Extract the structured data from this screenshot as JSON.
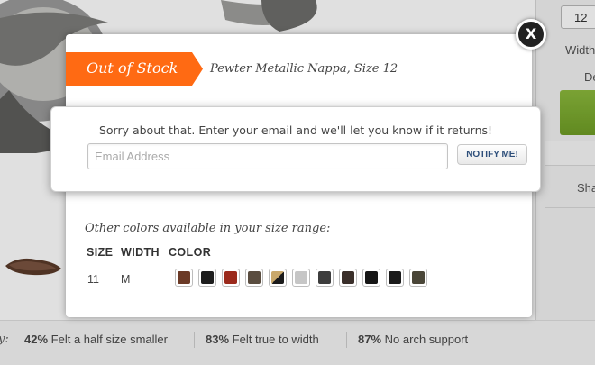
{
  "background": {
    "size_value": "12",
    "width_label": "Width",
    "de_label": "De",
    "share_label": "Sha",
    "fit": {
      "prefix": "y:",
      "stats": [
        {
          "percent": "42%",
          "text": "Felt a half size smaller"
        },
        {
          "percent": "83%",
          "text": "Felt true to width"
        },
        {
          "percent": "87%",
          "text": "No arch support"
        }
      ]
    }
  },
  "modal": {
    "close_label": "X",
    "banner_label": "Out of Stock",
    "banner_color": "#ff6a13",
    "product_name": "Pewter Metallic Nappa, Size 12",
    "notify": {
      "message": "Sorry about that. Enter your email and we'll let you know if it returns!",
      "email_placeholder": "Email Address",
      "button_label": "NOTIFY ME!"
    },
    "other_colors": {
      "label": "Other colors available in your size range:",
      "headers": {
        "size": "SIZE",
        "width": "WIDTH",
        "color": "COLOR"
      },
      "row": {
        "size": "11",
        "width": "M"
      },
      "swatches": [
        {
          "name": "brown",
          "color": "#6b3a26"
        },
        {
          "name": "black",
          "color": "#1d1d1d"
        },
        {
          "name": "red",
          "color": "#9b2a1c"
        },
        {
          "name": "taupe",
          "color": "#5a4d40"
        },
        {
          "name": "gold-black",
          "color": "gold-black"
        },
        {
          "name": "light-gray",
          "color": "#c6c6c6"
        },
        {
          "name": "charcoal",
          "color": "#3d3d3d"
        },
        {
          "name": "dark-brown",
          "color": "#3a2f2a"
        },
        {
          "name": "black-2",
          "color": "#161616"
        },
        {
          "name": "black-3",
          "color": "#1a1a1a"
        },
        {
          "name": "olive",
          "color": "#4a4638"
        }
      ]
    }
  }
}
